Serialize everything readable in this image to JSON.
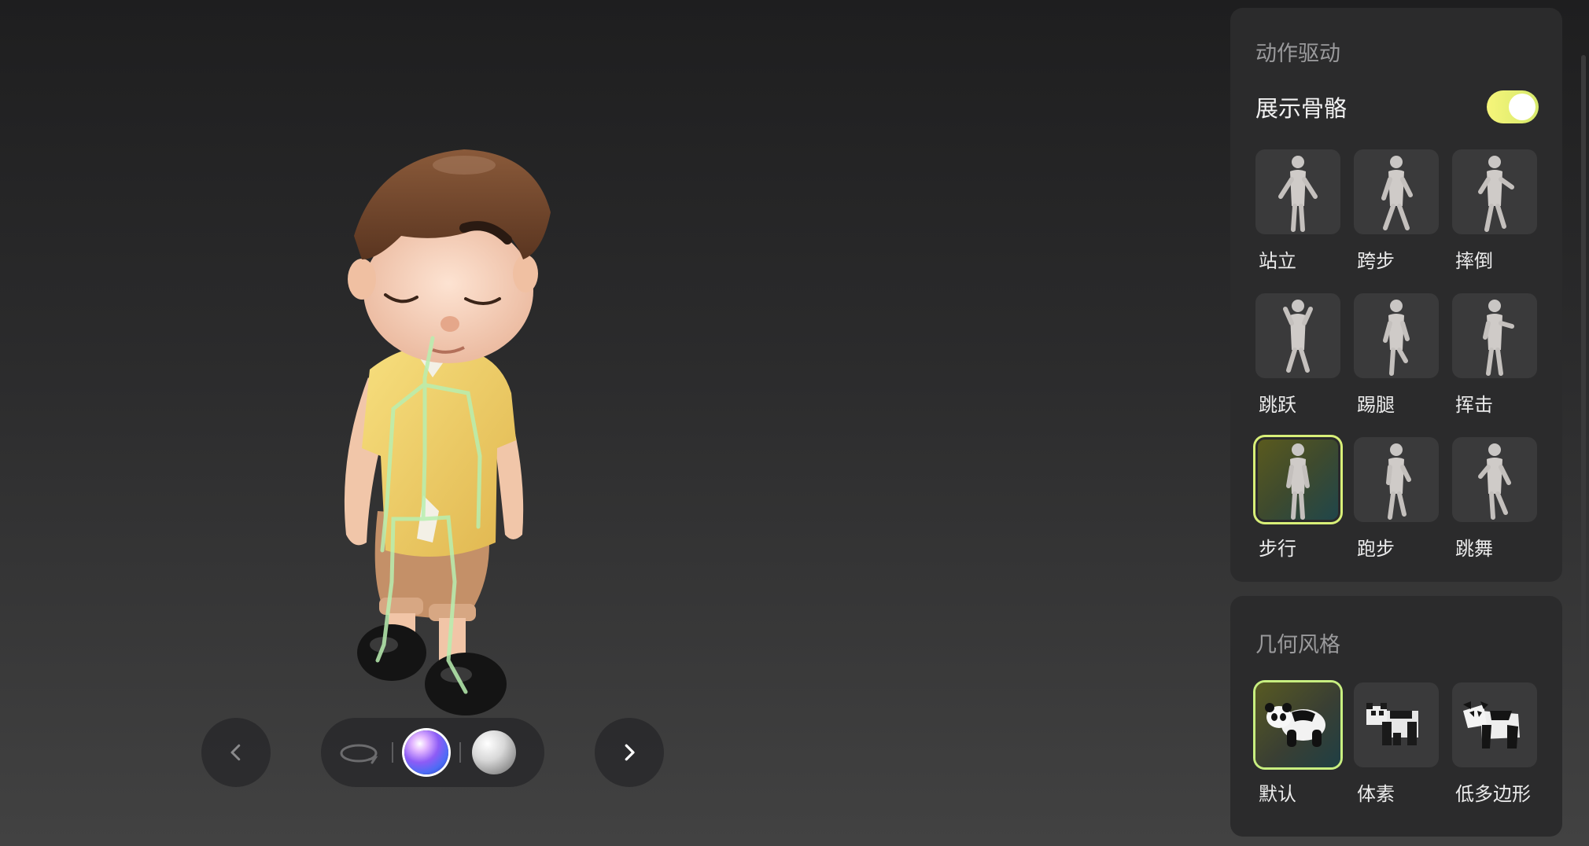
{
  "viewer": {
    "prev_icon": "chevron-left-icon",
    "next_icon": "chevron-right-icon",
    "rotate_icon": "rotate-icon",
    "materials": [
      {
        "name": "gradient-material",
        "color": "#8d5cf6",
        "selected": true
      },
      {
        "name": "plain-material",
        "color": "#d8d8d8",
        "selected": false
      }
    ],
    "skeleton_color": "#b8efb0"
  },
  "motion_panel": {
    "title": "动作驱动",
    "toggle_label": "展示骨骼",
    "toggle_on": true,
    "accent": "#e9f27a",
    "poses": [
      {
        "id": "stand",
        "label": "站立"
      },
      {
        "id": "stride",
        "label": "跨步"
      },
      {
        "id": "fall",
        "label": "摔倒"
      },
      {
        "id": "jump",
        "label": "跳跃"
      },
      {
        "id": "kick",
        "label": "踢腿"
      },
      {
        "id": "punch",
        "label": "挥击"
      },
      {
        "id": "walk",
        "label": "步行",
        "selected": true
      },
      {
        "id": "run",
        "label": "跑步"
      },
      {
        "id": "dance",
        "label": "跳舞"
      }
    ]
  },
  "geometry_panel": {
    "title": "几何风格",
    "styles": [
      {
        "id": "default",
        "label": "默认",
        "selected": true
      },
      {
        "id": "voxel",
        "label": "体素"
      },
      {
        "id": "lowpoly",
        "label": "低多边形"
      }
    ]
  }
}
